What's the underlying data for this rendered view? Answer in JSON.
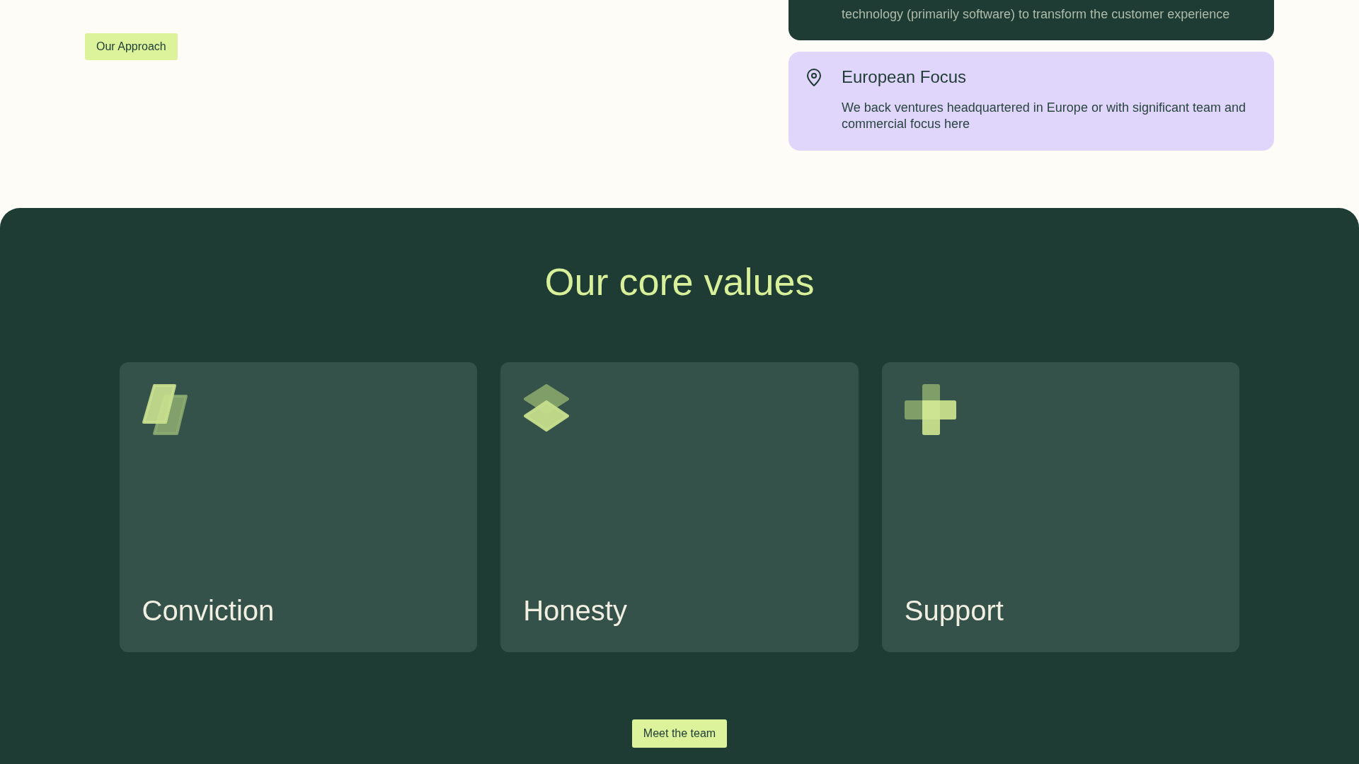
{
  "intro": {
    "approach_button": "Our Approach"
  },
  "feature_cards": [
    {
      "kind": "dark",
      "description": "technology (primarily software) to transform the customer experience"
    },
    {
      "kind": "light",
      "title": "European Focus",
      "description": "We back ventures headquartered in Europe or with significant team and commercial focus here"
    }
  ],
  "values_section": {
    "heading": "Our core values",
    "values": [
      {
        "title": "Conviction"
      },
      {
        "title": "Honesty"
      },
      {
        "title": "Support"
      }
    ],
    "team_button": "Meet the team"
  }
}
